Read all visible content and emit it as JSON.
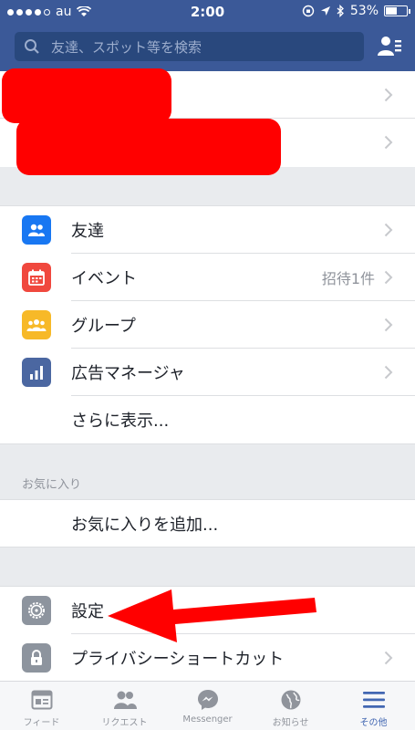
{
  "status_bar": {
    "carrier": "au",
    "time": "2:00",
    "battery": "53%",
    "battery_level": 0.53
  },
  "header": {
    "search_placeholder": "友達、スポット等を検索",
    "search_icon": "search-icon",
    "friends_icon": "friend-requests-icon"
  },
  "menu": {
    "items": [
      {
        "label": "友達",
        "icon": "friends-icon",
        "color": "#1877f2"
      },
      {
        "label": "イベント",
        "icon": "calendar-icon",
        "color": "#f0483e",
        "extra": "招待1件"
      },
      {
        "label": "グループ",
        "icon": "groups-icon",
        "color": "#f7b928"
      },
      {
        "label": "広告マネージャ",
        "icon": "ads-chart-icon",
        "color": "#4b67a1"
      }
    ],
    "see_more": "さらに表示..."
  },
  "favorites": {
    "title": "お気に入り",
    "add": "お気に入りを追加..."
  },
  "settings": {
    "items": [
      {
        "label": "設定",
        "icon": "gear-icon",
        "color": "#8d949e"
      },
      {
        "label": "プライバシーショートカット",
        "icon": "lock-icon",
        "color": "#8d949e"
      }
    ]
  },
  "tabs": [
    {
      "label": "フィード",
      "icon": "news-feed-icon"
    },
    {
      "label": "リクエスト",
      "icon": "friend-requests-icon"
    },
    {
      "label": "Messenger",
      "icon": "messenger-icon"
    },
    {
      "label": "お知らせ",
      "icon": "globe-icon"
    },
    {
      "label": "その他",
      "icon": "menu-icon",
      "active": true
    }
  ],
  "colors": {
    "brand": "#3b5998",
    "link": "#4267b2",
    "annotation_arrow": "#ff0000"
  }
}
